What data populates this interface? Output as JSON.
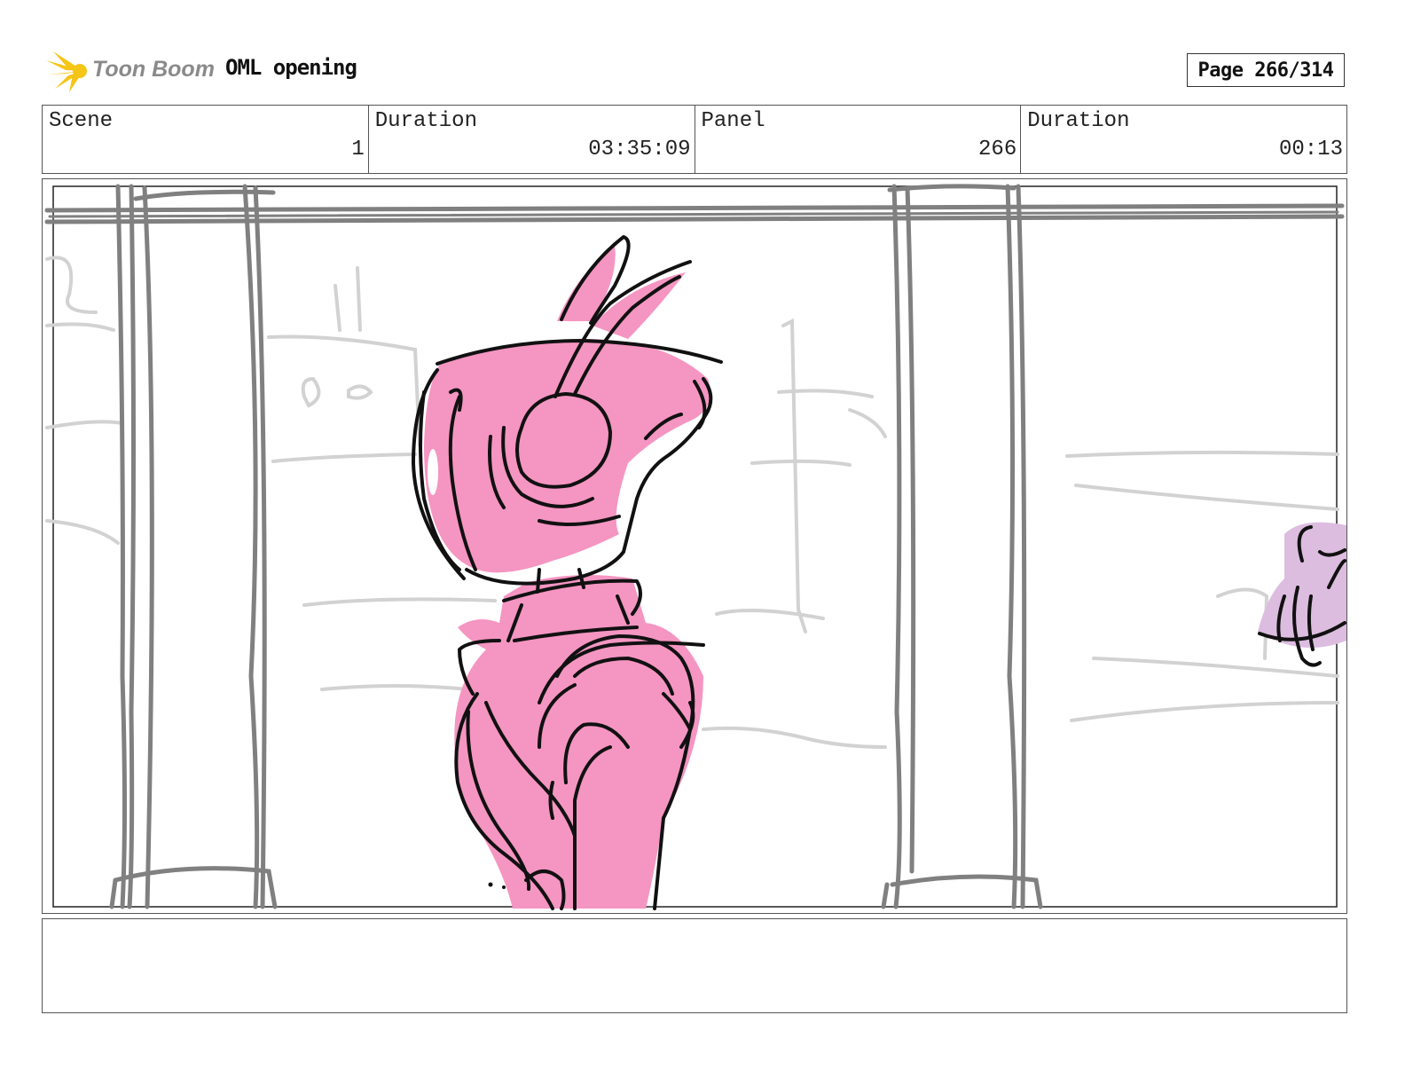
{
  "header": {
    "logo_text": "Toon Boom",
    "project_title": "OML opening",
    "page_label": "Page 266/314"
  },
  "info": [
    {
      "label": "Scene",
      "value": "1"
    },
    {
      "label": "Duration",
      "value": "03:35:09"
    },
    {
      "label": "Panel",
      "value": "266"
    },
    {
      "label": "Duration",
      "value": "00:13"
    }
  ],
  "notes": {
    "text": ""
  },
  "colors": {
    "character_fill": "#f595c2",
    "sketch_gray": "#808080",
    "background_sketch": "#cfcfcf",
    "secondary_fill": "#d9b9dc",
    "logo_yellow": "#f5c518"
  }
}
